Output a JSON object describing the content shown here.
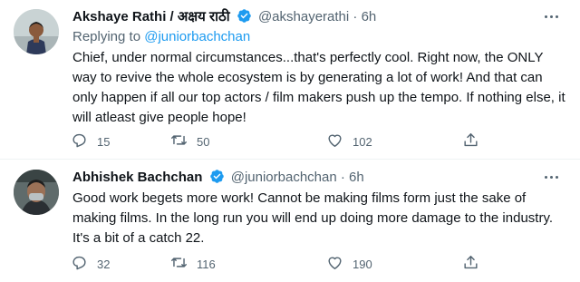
{
  "tweets": [
    {
      "name": "Akshaye Rathi / अक्षय राठी",
      "handle": "@akshayerathi",
      "separator": "·",
      "time": "6h",
      "replying_label": "Replying to",
      "replying_to": "@juniorbachchan",
      "text": "Chief, under normal circumstances...that's perfectly cool. Right now, the ONLY way to revive the whole ecosystem is by generating a lot of work! And that can only happen if all our top actors / film makers push up the tempo. If nothing else, it will atleast give people hope!",
      "replies": "15",
      "retweets": "50",
      "likes": "102"
    },
    {
      "name": "Abhishek Bachchan",
      "handle": "@juniorbachchan",
      "separator": "·",
      "time": "6h",
      "text": "Good work begets more work! Cannot be making films form just the sake of making films. In the long run you will end up doing more damage to the industry. It's a bit of a catch 22.",
      "replies": "32",
      "retweets": "116",
      "likes": "190"
    }
  ],
  "colors": {
    "accent": "#1d9bf0",
    "muted": "#536471",
    "text": "#0f1419",
    "divider": "#eff3f4"
  },
  "icons": [
    "verified-badge-icon",
    "more-options-icon",
    "reply-icon",
    "retweet-icon",
    "like-icon",
    "share-icon"
  ]
}
